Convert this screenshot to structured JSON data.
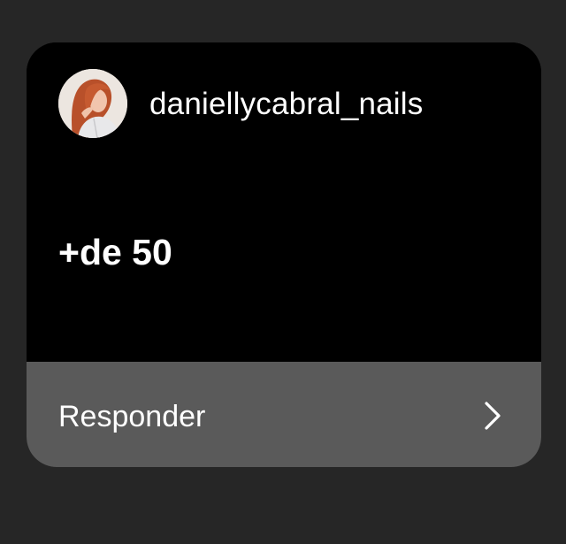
{
  "message_card": {
    "username": "daniellycabral_nails",
    "message_text": "+de 50",
    "reply_label": "Responder",
    "avatar_icon": "profile-photo",
    "chevron_icon": "chevron-right-icon"
  },
  "colors": {
    "page_background": "#262626",
    "card_background": "#000000",
    "reply_bar_background": "#5a5a5a",
    "text": "#ffffff"
  }
}
